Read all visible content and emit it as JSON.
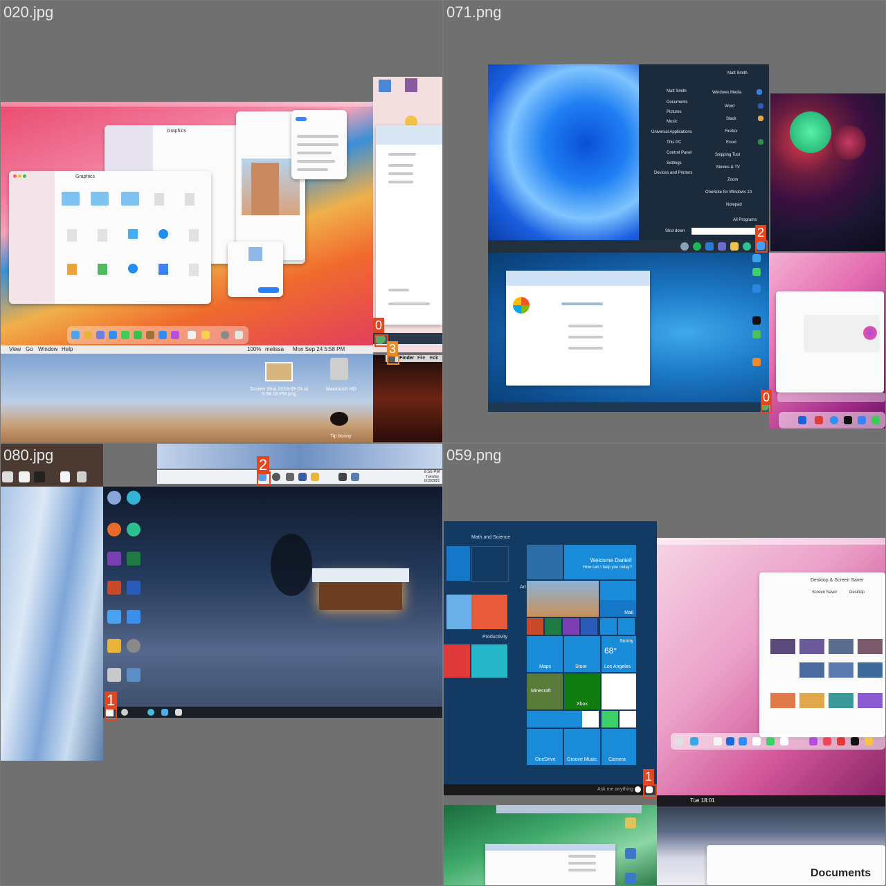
{
  "quadrants": [
    {
      "label": "020.jpg",
      "badges": [
        "0",
        "3"
      ]
    },
    {
      "label": "071.png",
      "badges": [
        "2",
        "0"
      ]
    },
    {
      "label": "080.jpg",
      "badges": [
        "2",
        "1"
      ]
    },
    {
      "label": "059.png",
      "badges": [
        "1"
      ]
    }
  ],
  "q1": {
    "finder_title": "Graphics",
    "finder_title2": "Graphics",
    "menubar": [
      "View",
      "Go",
      "Window",
      "Help"
    ],
    "status": "100%",
    "user": "melissa",
    "clock": "Mon Sep 24  5:58 PM",
    "screenshot_label": "Screen Shot 2018-09-24 at 5.58.16 PM.png",
    "hd_label": "Macintosh HD",
    "finder_menu": [
      "Finder",
      "File",
      "Edit"
    ],
    "trash_label": "Tip bunny"
  },
  "q2": {
    "start_user": "Matt Smith",
    "start_items": [
      "Windows Media",
      "Word",
      "Slack",
      "Firefox",
      "Excel",
      "Snipping Tool",
      "Movies & TV",
      "Zoom",
      "OneNote for Windows 10",
      "Notepad"
    ],
    "right_items": [
      "Matt Smith",
      "Documents",
      "Pictures",
      "Music",
      "Universal Applications",
      "This PC",
      "Control Panel",
      "Settings",
      "Devices and Printers"
    ],
    "all_programs": "All Programs",
    "shutdown": "Shut down"
  },
  "q3": {
    "desktop_icons": [
      "Recycle Bin",
      "Microsoft Edge",
      "Firefox",
      "OneNote",
      "Excel",
      "PowerPoint",
      "Word",
      "OneDrive",
      "File Explorer",
      "Settings",
      "Recycle",
      "Control Panel"
    ],
    "clock_time": "6:56 PM",
    "clock_day": "Tuesday",
    "clock_date": "6/15/2021"
  },
  "q4": {
    "section_math": "Math and Science",
    "section_art": "Art",
    "section_productivity": "Productivity",
    "welcome": "Welcome Daniel!",
    "welcome_sub": "How can I help you today?",
    "tiles": [
      "Mail",
      "Sunny",
      "Los Angeles",
      "Maps",
      "Store",
      "Xbox",
      "Minecraft",
      "Camera",
      "Groove Music",
      "OneDrive"
    ],
    "weather_temp": "68°",
    "search": "Ask me anything",
    "mac_clock": "Tue 18:01",
    "prefs_title": "Desktop & Screen Saver",
    "prefs_tabs": [
      "Desktop",
      "Screen Saver"
    ],
    "documents": "Documents"
  },
  "colors": {
    "badge": "#e0461f",
    "background": "#707070"
  }
}
